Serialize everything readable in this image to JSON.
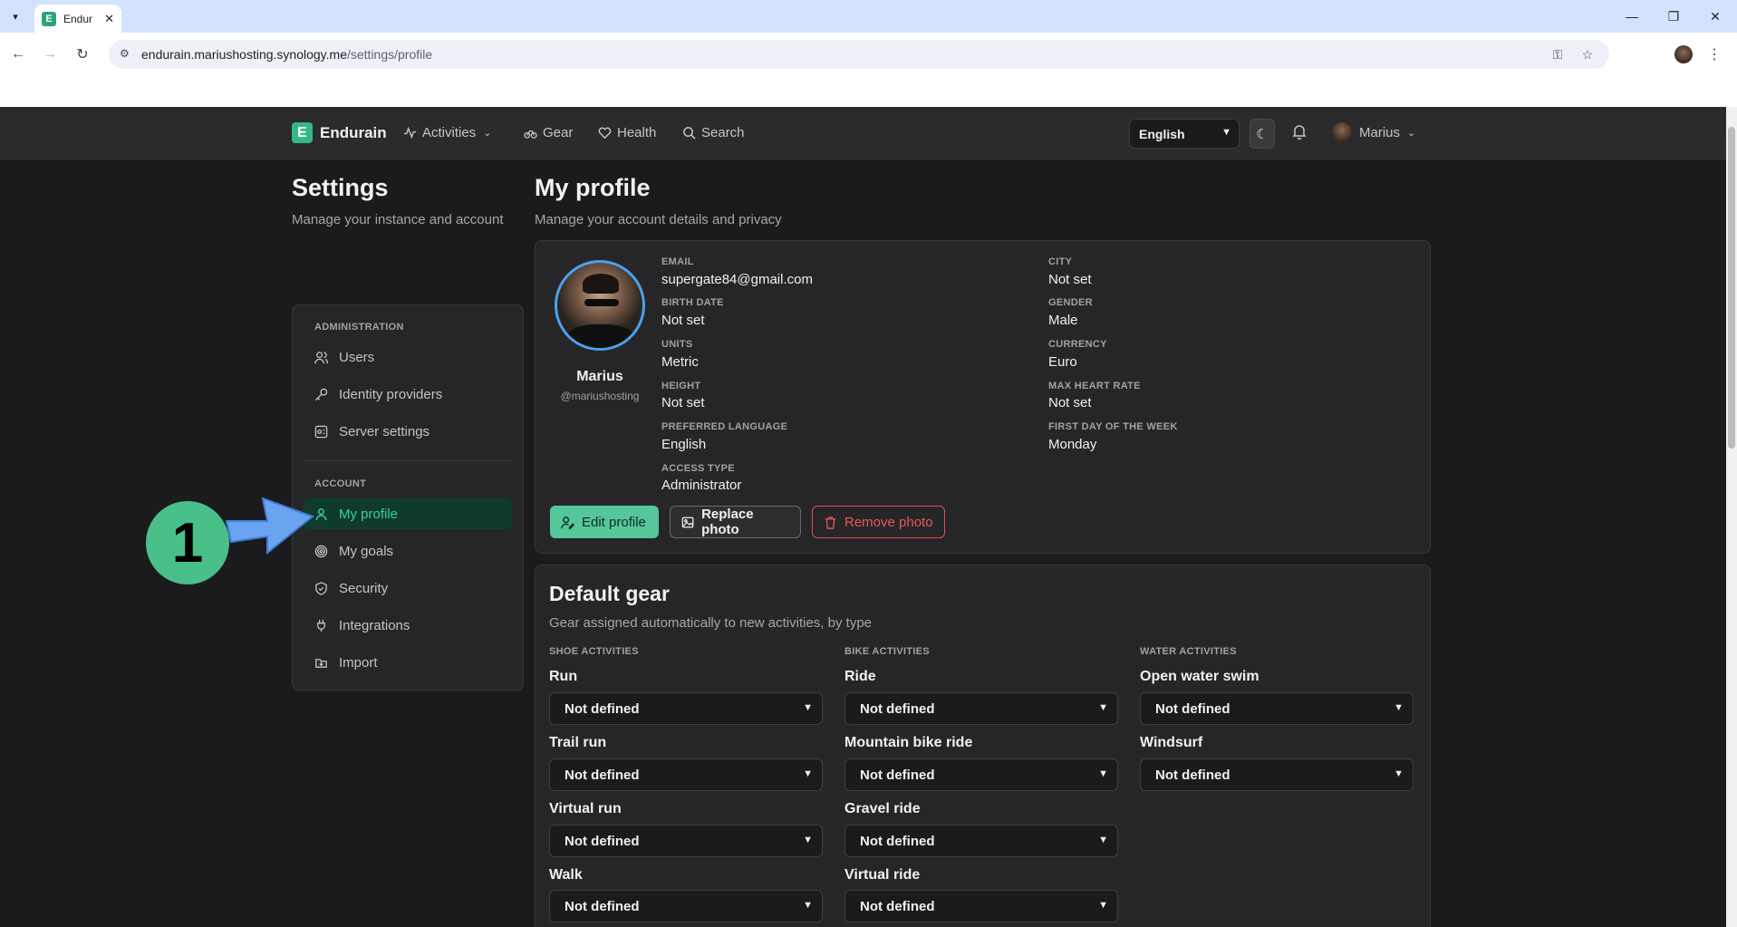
{
  "browser": {
    "tab_title": "Endur",
    "url_domain": "endurain.mariushosting.synology.me",
    "url_path": "/settings/profile"
  },
  "navbar": {
    "brand": "Endurain",
    "items": [
      {
        "label": "Activities",
        "icon": "activity-icon"
      },
      {
        "label": "Gear",
        "icon": "bike-icon"
      },
      {
        "label": "Health",
        "icon": "heart-icon"
      },
      {
        "label": "Search",
        "icon": "search-icon"
      }
    ],
    "language": "English",
    "user": "Marius"
  },
  "settings": {
    "title": "Settings",
    "subtitle": "Manage your instance and account"
  },
  "sidebar": {
    "admin_label": "ADMINISTRATION",
    "account_label": "ACCOUNT",
    "admin_items": [
      {
        "label": "Users",
        "icon": "users-icon"
      },
      {
        "label": "Identity providers",
        "icon": "key-icon"
      },
      {
        "label": "Server settings",
        "icon": "server-icon"
      }
    ],
    "account_items": [
      {
        "label": "My profile",
        "icon": "user-icon",
        "active": true
      },
      {
        "label": "My goals",
        "icon": "target-icon"
      },
      {
        "label": "Security",
        "icon": "shield-icon"
      },
      {
        "label": "Integrations",
        "icon": "plug-icon"
      },
      {
        "label": "Import",
        "icon": "import-icon"
      }
    ]
  },
  "profile": {
    "title": "My profile",
    "subtitle": "Manage your account details and privacy",
    "name": "Marius",
    "handle": "@mariushosting",
    "fields_left": [
      {
        "label": "EMAIL",
        "value": "supergate84@gmail.com"
      },
      {
        "label": "BIRTH DATE",
        "value": "Not set"
      },
      {
        "label": "UNITS",
        "value": "Metric"
      },
      {
        "label": "HEIGHT",
        "value": "Not set"
      },
      {
        "label": "PREFERRED LANGUAGE",
        "value": "English"
      },
      {
        "label": "ACCESS TYPE",
        "value": "Administrator"
      }
    ],
    "fields_right": [
      {
        "label": "CITY",
        "value": "Not set"
      },
      {
        "label": "GENDER",
        "value": "Male"
      },
      {
        "label": "CURRENCY",
        "value": "Euro"
      },
      {
        "label": "MAX HEART RATE",
        "value": "Not set"
      },
      {
        "label": "FIRST DAY OF THE WEEK",
        "value": "Monday"
      }
    ],
    "buttons": {
      "edit": "Edit profile",
      "replace": "Replace photo",
      "remove": "Remove photo"
    }
  },
  "gear": {
    "title": "Default gear",
    "subtitle": "Gear assigned automatically to new activities, by type",
    "columns": [
      {
        "label": "SHOE ACTIVITIES",
        "items": [
          {
            "type": "Run",
            "value": "Not defined"
          },
          {
            "type": "Trail run",
            "value": "Not defined"
          },
          {
            "type": "Virtual run",
            "value": "Not defined"
          },
          {
            "type": "Walk",
            "value": "Not defined"
          }
        ]
      },
      {
        "label": "BIKE ACTIVITIES",
        "items": [
          {
            "type": "Ride",
            "value": "Not defined"
          },
          {
            "type": "Mountain bike ride",
            "value": "Not defined"
          },
          {
            "type": "Gravel ride",
            "value": "Not defined"
          },
          {
            "type": "Virtual ride",
            "value": "Not defined"
          }
        ]
      },
      {
        "label": "WATER ACTIVITIES",
        "items": [
          {
            "type": "Open water swim",
            "value": "Not defined"
          },
          {
            "type": "Windsurf",
            "value": "Not defined"
          }
        ]
      }
    ]
  },
  "annotation": {
    "step": "1"
  },
  "colors": {
    "accent": "#37b785",
    "active_bg": "#0f3b2e",
    "danger": "#e75a58",
    "annotation": "#49c08a"
  }
}
